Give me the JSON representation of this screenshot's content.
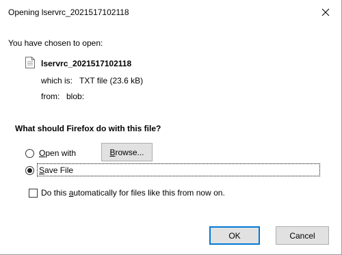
{
  "window": {
    "title": "Opening lservrc_2021517102118"
  },
  "dialog": {
    "intro": "You have chosen to open:",
    "file_name": "lservrc_2021517102118",
    "which_is_label": "which is:",
    "which_is_value": "TXT file (23.6 kB)",
    "from_label": "from:",
    "from_value": "blob:",
    "question": "What should Firefox do with this file?",
    "open_with": {
      "prefix": "",
      "accel": "O",
      "rest": "pen with",
      "selected": false
    },
    "browse": {
      "accel": "B",
      "rest": "rowse..."
    },
    "save_file": {
      "accel": "S",
      "rest": "ave File",
      "selected": true
    },
    "auto_checkbox": {
      "prefix": "Do this ",
      "accel": "a",
      "rest": "utomatically for files like this from now on.",
      "checked": false
    },
    "ok_label": "OK",
    "cancel_label": "Cancel"
  },
  "icons": {
    "close": "close-icon",
    "file": "text-file-icon"
  }
}
